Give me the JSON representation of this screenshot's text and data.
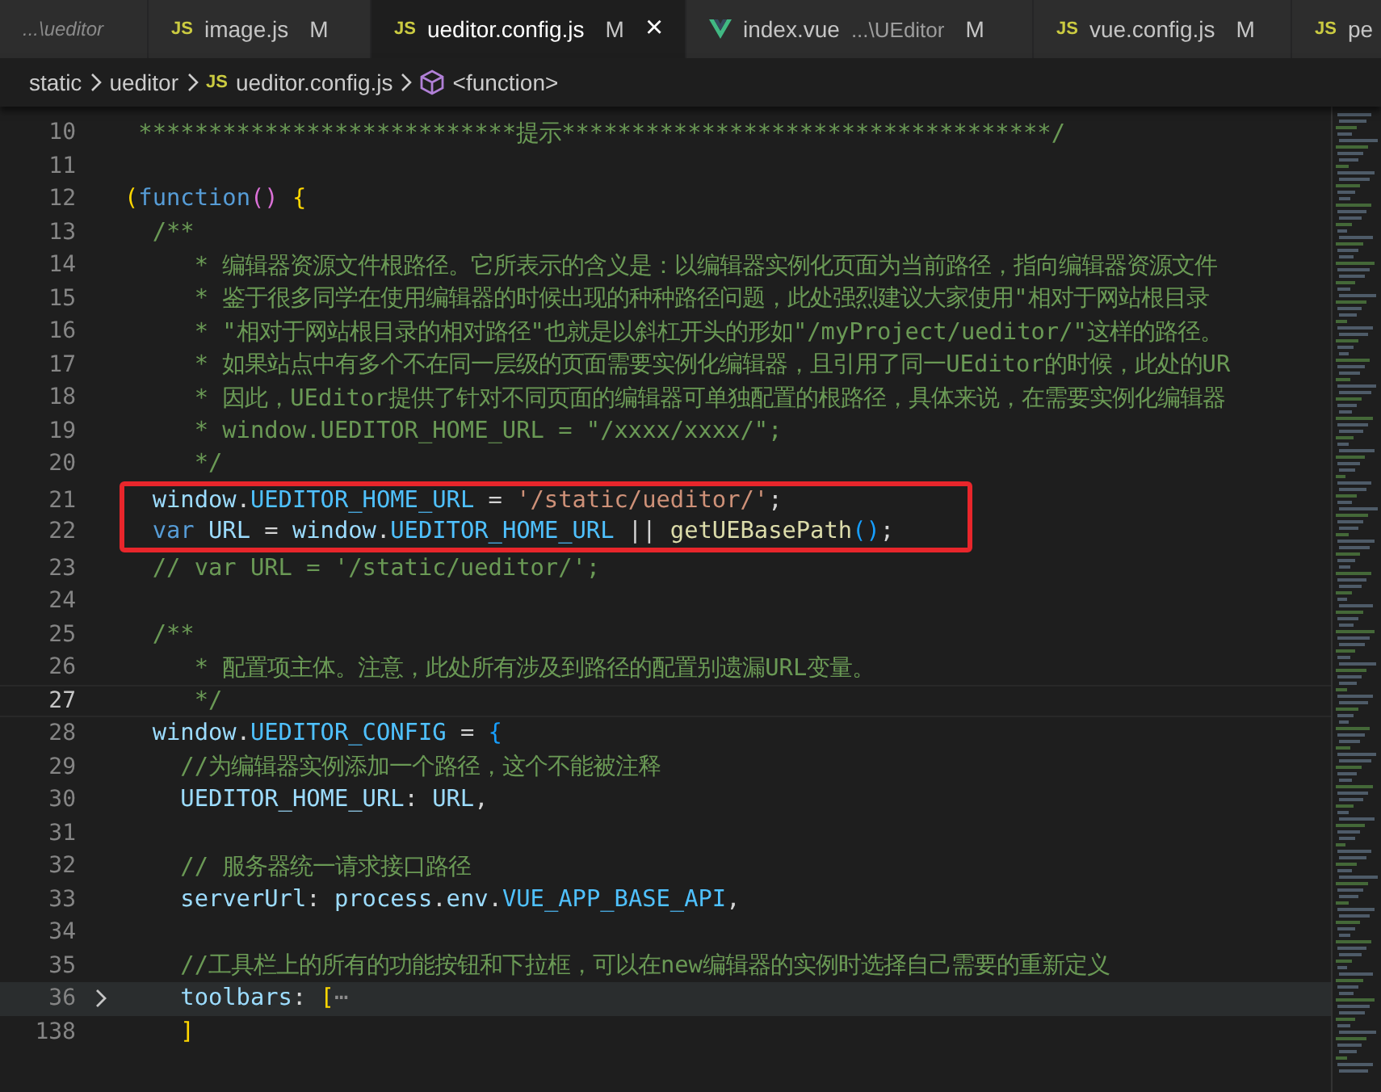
{
  "tabs": [
    {
      "kind": "plain",
      "label": "...\\ueditor",
      "preview": true,
      "selected": false
    },
    {
      "kind": "js",
      "icon": "JS",
      "label": "image.js",
      "badge": "M",
      "preview": false,
      "selected": false
    },
    {
      "kind": "js",
      "icon": "JS",
      "label": "ueditor.config.js",
      "badge": "M",
      "close": "×",
      "preview": false,
      "selected": true
    },
    {
      "kind": "vue",
      "label": "index.vue",
      "description": "...\\UEditor",
      "badge": "M",
      "preview": false,
      "selected": false
    },
    {
      "kind": "js",
      "icon": "JS",
      "label": "vue.config.js",
      "badge": "M",
      "preview": false,
      "selected": false
    },
    {
      "kind": "js",
      "icon": "JS",
      "label": "pe",
      "preview": false,
      "selected": false
    }
  ],
  "breadcrumb": [
    {
      "kind": "folder",
      "label": "static"
    },
    {
      "kind": "folder",
      "label": "ueditor"
    },
    {
      "kind": "js",
      "icon": "JS",
      "label": "ueditor.config.js"
    },
    {
      "kind": "symbol",
      "label": "<function>"
    }
  ],
  "lines": [
    {
      "number": "10",
      "active": false,
      "highlighted": false,
      "boxed": false,
      "folded": false,
      "tokens": [
        {
          "kind": "comment",
          "text": " ***************************提示***********************************/"
        }
      ]
    },
    {
      "number": "11",
      "active": false,
      "highlighted": false,
      "boxed": false,
      "folded": false
    },
    {
      "number": "12",
      "active": false,
      "highlighted": false,
      "boxed": false,
      "folded": false,
      "tokens": [
        {
          "kind": "bracket1",
          "text": "("
        },
        {
          "kind": "keyword",
          "text": "function"
        },
        {
          "kind": "bracket2",
          "text": "()"
        },
        {
          "kind": "bracket1",
          "text": " {"
        }
      ]
    },
    {
      "number": "13",
      "active": false,
      "highlighted": false,
      "boxed": false,
      "folded": false,
      "tokens": [
        {
          "kind": "comment",
          "text": "  /**"
        }
      ]
    },
    {
      "number": "14",
      "active": false,
      "highlighted": false,
      "boxed": false,
      "folded": false,
      "tokens": [
        {
          "kind": "comment",
          "text": "     * 编辑器资源文件根路径。它所表示的含义是：以编辑器实例化页面为当前路径，指向编辑器资源文件"
        }
      ]
    },
    {
      "number": "15",
      "active": false,
      "highlighted": false,
      "boxed": false,
      "folded": false,
      "tokens": [
        {
          "kind": "comment",
          "text": "     * 鉴于很多同学在使用编辑器的时候出现的种种路径问题，此处强烈建议大家使用\"相对于网站根目录"
        }
      ]
    },
    {
      "number": "16",
      "active": false,
      "highlighted": false,
      "boxed": false,
      "folded": false,
      "tokens": [
        {
          "kind": "comment",
          "text": "     * \"相对于网站根目录的相对路径\"也就是以斜杠开头的形如\"/myProject/ueditor/\"这样的路径。"
        }
      ]
    },
    {
      "number": "17",
      "active": false,
      "highlighted": false,
      "boxed": false,
      "folded": false,
      "tokens": [
        {
          "kind": "comment",
          "text": "     * 如果站点中有多个不在同一层级的页面需要实例化编辑器，且引用了同一UEditor的时候，此处的UR"
        }
      ]
    },
    {
      "number": "18",
      "active": false,
      "highlighted": false,
      "boxed": false,
      "folded": false,
      "tokens": [
        {
          "kind": "comment",
          "text": "     * 因此，UEditor提供了针对不同页面的编辑器可单独配置的根路径，具体来说，在需要实例化编辑器"
        }
      ]
    },
    {
      "number": "19",
      "active": false,
      "highlighted": false,
      "boxed": false,
      "folded": false,
      "tokens": [
        {
          "kind": "comment",
          "text": "     * window.UEDITOR_HOME_URL = \"/xxxx/xxxx/\";"
        }
      ]
    },
    {
      "number": "20",
      "active": false,
      "highlighted": false,
      "boxed": false,
      "folded": false,
      "tokens": [
        {
          "kind": "comment",
          "text": "     */"
        }
      ]
    },
    {
      "number": "21",
      "active": false,
      "highlighted": false,
      "boxed": true,
      "folded": false,
      "tokens": [
        {
          "kind": "var",
          "text": "  window"
        },
        {
          "kind": "plain",
          "text": "."
        },
        {
          "kind": "const",
          "text": "UEDITOR_HOME_URL"
        },
        {
          "kind": "plain",
          "text": " = "
        },
        {
          "kind": "string",
          "text": "'/static/ueditor/'"
        },
        {
          "kind": "plain",
          "text": ";"
        }
      ]
    },
    {
      "number": "22",
      "active": false,
      "highlighted": false,
      "boxed": true,
      "folded": false,
      "tokens": [
        {
          "kind": "keyword",
          "text": "  var"
        },
        {
          "kind": "var",
          "text": " URL"
        },
        {
          "kind": "plain",
          "text": " = "
        },
        {
          "kind": "var",
          "text": "window"
        },
        {
          "kind": "plain",
          "text": "."
        },
        {
          "kind": "const",
          "text": "UEDITOR_HOME_URL"
        },
        {
          "kind": "plain",
          "text": " || "
        },
        {
          "kind": "func",
          "text": "getUEBasePath"
        },
        {
          "kind": "bracket3",
          "text": "()"
        },
        {
          "kind": "plain",
          "text": ";"
        }
      ]
    },
    {
      "number": "23",
      "active": false,
      "highlighted": false,
      "boxed": false,
      "folded": false,
      "tokens": [
        {
          "kind": "comment",
          "text": "  // var URL = '/static/ueditor/';"
        }
      ]
    },
    {
      "number": "24",
      "active": false,
      "highlighted": false,
      "boxed": false,
      "folded": false
    },
    {
      "number": "25",
      "active": false,
      "highlighted": false,
      "boxed": false,
      "folded": false,
      "tokens": [
        {
          "kind": "comment",
          "text": "  /**"
        }
      ]
    },
    {
      "number": "26",
      "active": false,
      "highlighted": false,
      "boxed": false,
      "folded": false,
      "tokens": [
        {
          "kind": "comment",
          "text": "     * 配置项主体。注意，此处所有涉及到路径的配置别遗漏URL变量。"
        }
      ]
    },
    {
      "number": "27",
      "active": true,
      "highlighted": false,
      "boxed": false,
      "folded": false,
      "tokens": [
        {
          "kind": "comment",
          "text": "     */"
        }
      ]
    },
    {
      "number": "28",
      "active": false,
      "highlighted": false,
      "boxed": false,
      "folded": false,
      "tokens": [
        {
          "kind": "var",
          "text": "  window"
        },
        {
          "kind": "plain",
          "text": "."
        },
        {
          "kind": "const",
          "text": "UEDITOR_CONFIG"
        },
        {
          "kind": "plain",
          "text": " = "
        },
        {
          "kind": "bracket3",
          "text": "{"
        }
      ]
    },
    {
      "number": "29",
      "active": false,
      "highlighted": false,
      "boxed": false,
      "folded": false,
      "tokens": [
        {
          "kind": "comment",
          "text": "    //为编辑器实例添加一个路径，这个不能被注释"
        }
      ]
    },
    {
      "number": "30",
      "active": false,
      "highlighted": false,
      "boxed": false,
      "folded": false,
      "tokens": [
        {
          "kind": "var",
          "text": "    UEDITOR_HOME_URL"
        },
        {
          "kind": "plain",
          "text": ": "
        },
        {
          "kind": "var",
          "text": "URL"
        },
        {
          "kind": "plain",
          "text": ","
        }
      ]
    },
    {
      "number": "31",
      "active": false,
      "highlighted": false,
      "boxed": false,
      "folded": false
    },
    {
      "number": "32",
      "active": false,
      "highlighted": false,
      "boxed": false,
      "folded": false,
      "tokens": [
        {
          "kind": "comment",
          "text": "    // 服务器统一请求接口路径"
        }
      ]
    },
    {
      "number": "33",
      "active": false,
      "highlighted": false,
      "boxed": false,
      "folded": false,
      "tokens": [
        {
          "kind": "var",
          "text": "    serverUrl"
        },
        {
          "kind": "plain",
          "text": ": "
        },
        {
          "kind": "var",
          "text": "process"
        },
        {
          "kind": "plain",
          "text": "."
        },
        {
          "kind": "var",
          "text": "env"
        },
        {
          "kind": "plain",
          "text": "."
        },
        {
          "kind": "const",
          "text": "VUE_APP_BASE_API"
        },
        {
          "kind": "plain",
          "text": ","
        }
      ]
    },
    {
      "number": "34",
      "active": false,
      "highlighted": false,
      "boxed": false,
      "folded": false
    },
    {
      "number": "35",
      "active": false,
      "highlighted": false,
      "boxed": false,
      "folded": false,
      "tokens": [
        {
          "kind": "comment",
          "text": "    //工具栏上的所有的功能按钮和下拉框，可以在new编辑器的实例时选择自己需要的重新定义"
        }
      ]
    },
    {
      "number": "36",
      "active": false,
      "highlighted": true,
      "boxed": false,
      "folded": true,
      "tokens": [
        {
          "kind": "var",
          "text": "    toolbars"
        },
        {
          "kind": "plain",
          "text": ": "
        },
        {
          "kind": "bracket1",
          "text": "["
        },
        {
          "kind": "fold",
          "text": "⋯"
        }
      ]
    },
    {
      "number": "138",
      "active": false,
      "highlighted": false,
      "boxed": false,
      "folded": false,
      "tokens": [
        {
          "kind": "bracket1",
          "text": "    ]"
        }
      ]
    }
  ]
}
